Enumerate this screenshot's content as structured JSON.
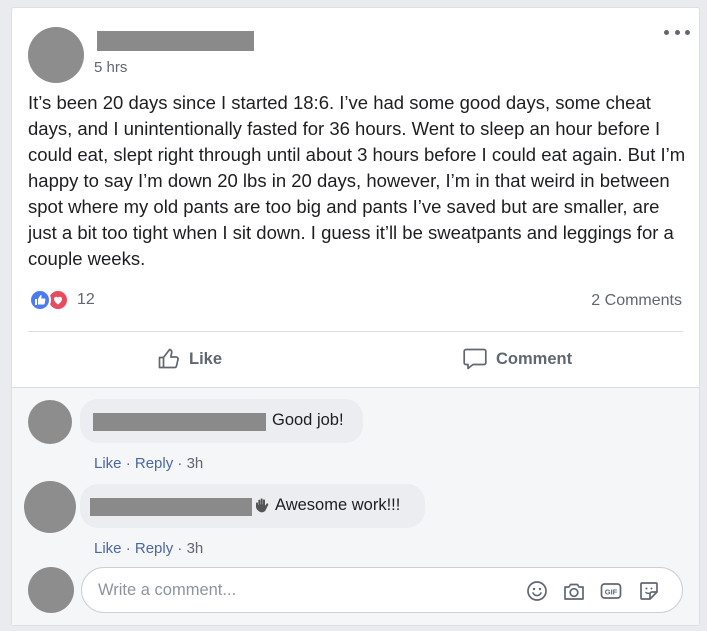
{
  "post": {
    "timestamp": "5 hrs",
    "text": "It’s been 20 days since I started 18:6. I’ve had some good days, some cheat days, and I unintentionally fasted for 36 hours. Went to sleep an hour before I could eat, slept right through until about 3 hours before I could eat again. But I’m happy to say I’m down 20 lbs in 20 days, however, I’m in that weird in between spot where my old pants are too big and pants I’ve saved but are smaller, are just a bit too tight when I sit down. I guess it’ll be sweatpants and leggings for a couple weeks.",
    "reaction_count": "12",
    "comments_count": "2 Comments",
    "reactions": [
      "like",
      "love"
    ]
  },
  "actions": {
    "like_label": "Like",
    "comment_label": "Comment"
  },
  "comments": [
    {
      "text": "Good job!",
      "like": "Like",
      "reply": "Reply",
      "time": "3h"
    },
    {
      "text": "Awesome work!!!",
      "emoji": "waving-hand",
      "like": "Like",
      "reply": "Reply",
      "time": "3h"
    }
  ],
  "composer": {
    "placeholder": "Write a comment...",
    "icons": [
      "emoji-icon",
      "camera-icon",
      "gif-icon",
      "sticker-icon"
    ]
  },
  "colors": {
    "like_blue": "#4a7bf2",
    "love_red": "#e84a5f",
    "link": "#4b67a1",
    "muted": "#606770"
  }
}
